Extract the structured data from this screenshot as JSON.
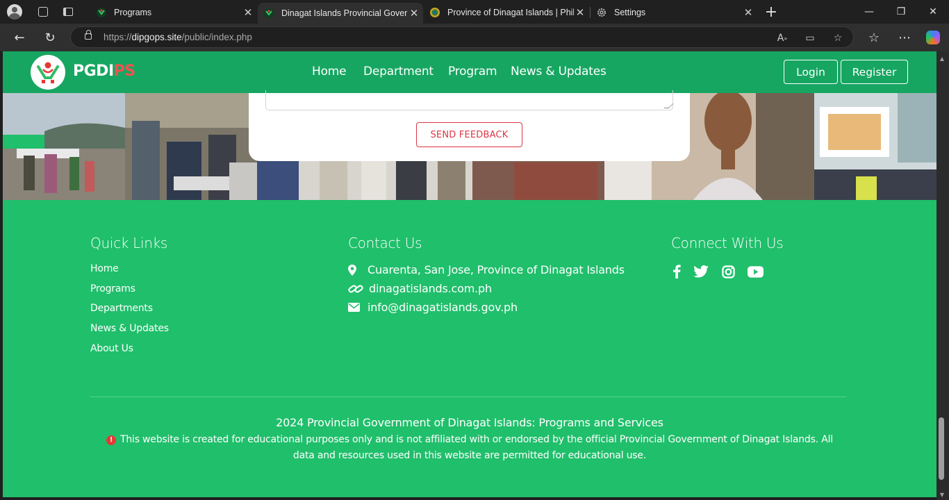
{
  "browser": {
    "tabs": [
      {
        "title": "Programs",
        "active": false
      },
      {
        "title": "Dinagat Islands Provincial Govern",
        "active": true
      },
      {
        "title": "Province of Dinagat Islands | Phili",
        "active": false
      },
      {
        "title": "Settings",
        "active": false
      }
    ],
    "url": {
      "prefix": "https://",
      "domain": "dipgops.site",
      "path": "/public/index.php"
    }
  },
  "site": {
    "brand": {
      "main": "PGDI",
      "accent": "PS"
    },
    "nav": [
      "Home",
      "Department",
      "Program",
      "News & Updates"
    ],
    "login_label": "Login",
    "register_label": "Register",
    "send_feedback_label": "SEND FEEDBACK"
  },
  "footer": {
    "quick_links": {
      "heading": "Quick Links",
      "items": [
        "Home",
        "Programs",
        "Departments",
        "News & Updates",
        "About Us"
      ]
    },
    "contact": {
      "heading": "Contact Us",
      "address": "Cuarenta, San Jose, Province of Dinagat Islands",
      "website": "dinagatislands.com.ph",
      "email": "info@dinagatislands.gov.ph"
    },
    "connect": {
      "heading": "Connect With Us",
      "icons": [
        "facebook-icon",
        "twitter-icon",
        "instagram-icon",
        "youtube-icon"
      ]
    },
    "copyright": "2024 Provincial Government of Dinagat Islands: Programs and Services",
    "disclaimer": "This website is created for educational purposes only and is not affiliated with or endorsed by the official Provincial Government of Dinagat Islands. All data and resources used in this website are permitted for educational use."
  },
  "colors": {
    "header_green": "#16a661",
    "footer_green": "#20bf6b",
    "accent_red": "#ef5350",
    "button_red": "#dc3545"
  }
}
